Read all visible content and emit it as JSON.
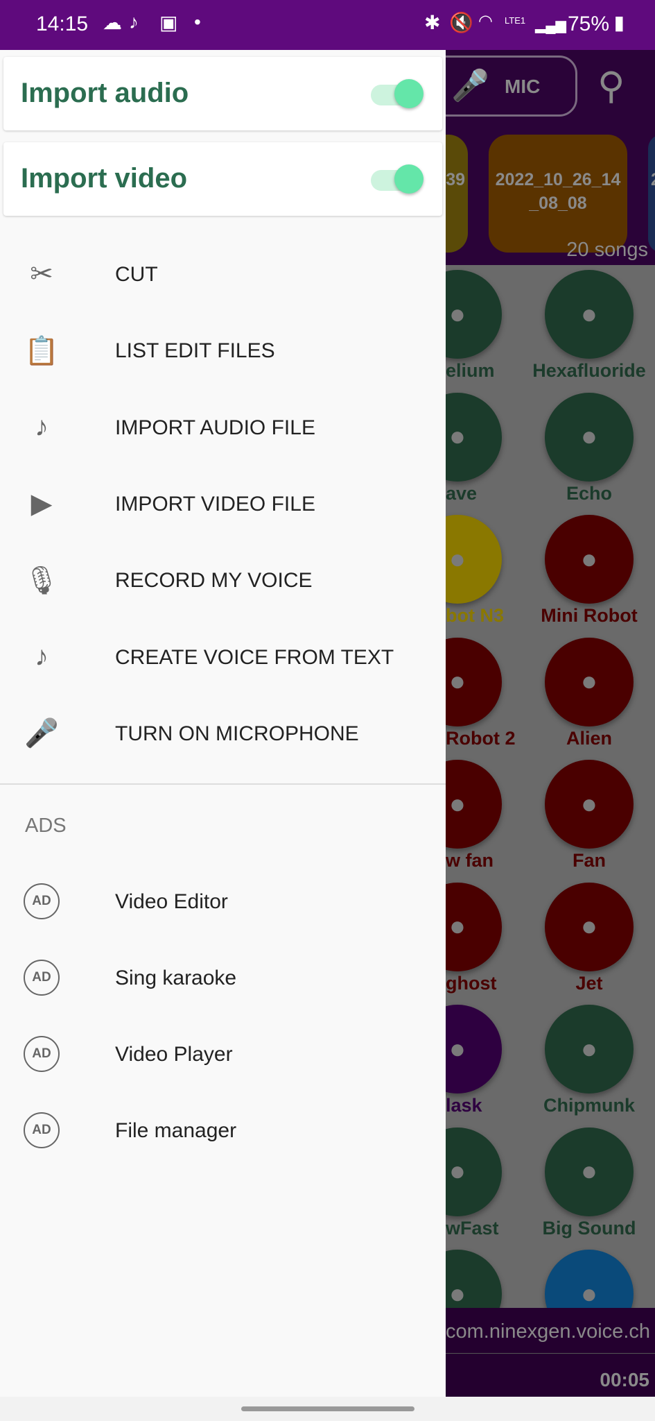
{
  "status_bar": {
    "time": "14:15",
    "battery": "75%",
    "network": "LTE1"
  },
  "background": {
    "mic_label": "MIC",
    "tiles": [
      {
        "label": "39",
        "color": "#5a4a08"
      },
      {
        "label": "2022_10_26_14_08_08",
        "color": "#5a3300"
      },
      {
        "label": "2",
        "color": "#1a2c55"
      }
    ],
    "songs_count": "20 songs",
    "effects": [
      {
        "label": "elium",
        "color": "#1b3b2b",
        "icon": "balloon-icon"
      },
      {
        "label": "Hexafluoride",
        "color": "#1b3b2b",
        "icon": "bomb-icon"
      },
      {
        "label": "ave",
        "color": "#1b3b2b",
        "icon": "cave-icon"
      },
      {
        "label": "Echo",
        "color": "#1b3b2b",
        "icon": "echo-icon"
      },
      {
        "label": "bot N3",
        "color": "#8a7800",
        "icon": "robot-icon"
      },
      {
        "label": "Mini Robot",
        "color": "#4a0000",
        "icon": "android-icon"
      },
      {
        "label": "Robot 2",
        "color": "#4a0000",
        "icon": "robot-icon"
      },
      {
        "label": "Alien",
        "color": "#4a0000",
        "icon": "alien-icon"
      },
      {
        "label": "w fan",
        "color": "#4a0000",
        "icon": "fan-icon"
      },
      {
        "label": "Fan",
        "color": "#4a0000",
        "icon": "flower-icon"
      },
      {
        "label": "ghost",
        "color": "#4a0000",
        "icon": "ghost-icon"
      },
      {
        "label": "Jet",
        "color": "#4a0000",
        "icon": "jet-icon"
      },
      {
        "label": "lask",
        "color": "#2e0040",
        "icon": "mask-icon"
      },
      {
        "label": "Chipmunk",
        "color": "#1b3b2b",
        "icon": "chipmunk-icon"
      },
      {
        "label": "wFast",
        "color": "#1b3b2b",
        "icon": "fast-forward-icon"
      },
      {
        "label": "Big Sound",
        "color": "#1b3b2b",
        "icon": "speaker-icon"
      },
      {
        "label": "",
        "color": "#1b3b2b",
        "icon": "horn-icon"
      },
      {
        "label": "",
        "color": "#0a4a7a",
        "icon": "equalizer-icon"
      }
    ],
    "player": {
      "package": "com.ninexgen.voice.ch",
      "time": "00:05"
    }
  },
  "drawer": {
    "toggles": [
      {
        "label": "Import audio",
        "on": true
      },
      {
        "label": "Import video",
        "on": true
      }
    ],
    "menu": [
      {
        "label": "CUT",
        "icon": "scissors-icon",
        "glyph": "✂"
      },
      {
        "label": "LIST EDIT FILES",
        "icon": "clipboard-icon",
        "glyph": "📋"
      },
      {
        "label": "IMPORT AUDIO FILE",
        "icon": "music-note-icon",
        "glyph": "♪"
      },
      {
        "label": "IMPORT VIDEO FILE",
        "icon": "play-icon",
        "glyph": "▶"
      },
      {
        "label": "RECORD MY VOICE",
        "icon": "microphone-icon",
        "glyph": "🎙"
      },
      {
        "label": "CREATE VOICE FROM TEXT",
        "icon": "music-circle-icon",
        "glyph": "♪"
      },
      {
        "label": "TURN ON MICROPHONE",
        "icon": "mic-handheld-icon",
        "glyph": "🎤"
      }
    ],
    "ads_header": "ADS",
    "ad_badge": "AD",
    "ads": [
      {
        "label": "Video Editor"
      },
      {
        "label": "Sing karaoke"
      },
      {
        "label": "Video Player"
      },
      {
        "label": "File manager"
      }
    ]
  },
  "colors": {
    "status_bar": "#5f0a7d",
    "accent_green": "#2b6d50",
    "toggle_thumb": "#64e6a9"
  }
}
